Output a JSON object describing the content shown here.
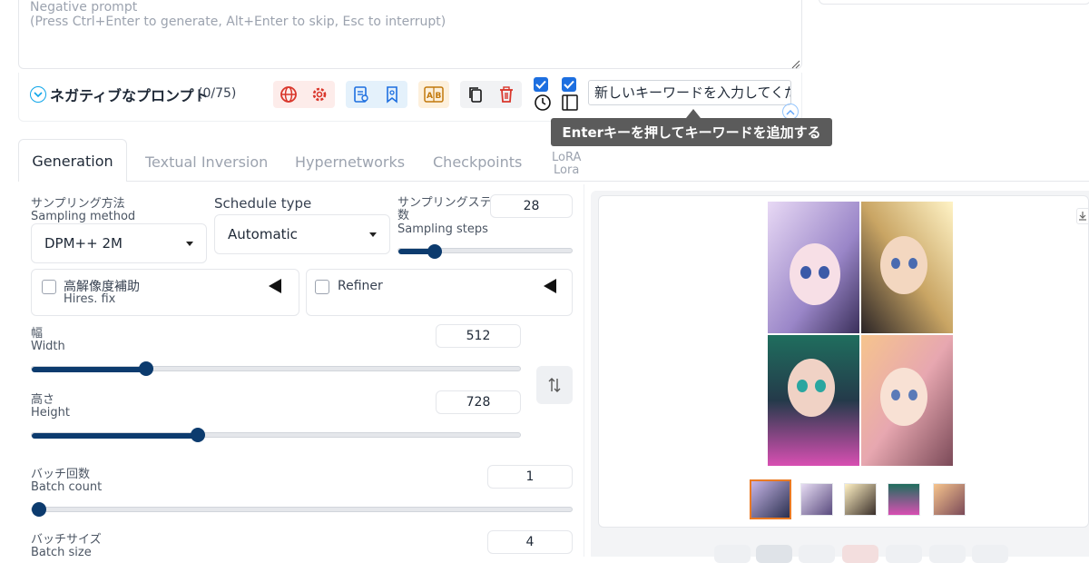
{
  "negative_prompt": {
    "placeholder_line1": "Negative prompt",
    "placeholder_line2": "(Press Ctrl+Enter to generate, Alt+Enter to skip, Esc to interrupt)",
    "section_title": "ネガティブなプロンプト",
    "token_count": "(0/75)"
  },
  "toolbar": {
    "icons": [
      "globe-icon",
      "gear-icon",
      "document-icon",
      "bookmark-icon",
      "translate-icon",
      "copy-icon",
      "trash-icon"
    ],
    "keyword_input_placeholder": "新しいキーワードを入力してください",
    "tooltip": "Enterキーを押してキーワードを追加する"
  },
  "tabs": {
    "generation": "Generation",
    "textual_inversion": "Textual Inversion",
    "hypernetworks": "Hypernetworks",
    "checkpoints": "Checkpoints",
    "lora_line1": "LoRA",
    "lora_line2": "Lora"
  },
  "params": {
    "sampling_method": {
      "label_ja": "サンプリング方法",
      "label_en": "Sampling method",
      "value": "DPM++ 2M"
    },
    "schedule_type": {
      "label": "Schedule type",
      "value": "Automatic"
    },
    "sampling_steps": {
      "label_ja_1": "サンプリングステップ",
      "label_ja_2": "数",
      "label_en": "Sampling steps",
      "value": "28",
      "fraction": 0.19
    },
    "hires_fix": {
      "label_ja": "高解像度補助",
      "label_en": "Hires. fix",
      "checked": false
    },
    "refiner": {
      "label": "Refiner",
      "checked": false
    },
    "width": {
      "label_ja": "幅",
      "label_en": "Width",
      "value": "512",
      "fraction": 0.23
    },
    "height": {
      "label_ja": "高さ",
      "label_en": "Height",
      "value": "728",
      "fraction": 0.34
    },
    "batch_count": {
      "label_ja": "バッチ回数",
      "label_en": "Batch count",
      "value": "1",
      "fraction": 0.0
    },
    "batch_size": {
      "label_ja": "バッチサイズ",
      "label_en": "Batch size",
      "value": "4"
    }
  },
  "gallery": {
    "thumbnail_count": 5,
    "selected_index": 0
  },
  "colors": {
    "accent": "#0c3b6e",
    "tooltip_bg": "#5b5b5b",
    "selected_thumb": "#ea7a23",
    "checkbox": "#1d6fe0"
  }
}
